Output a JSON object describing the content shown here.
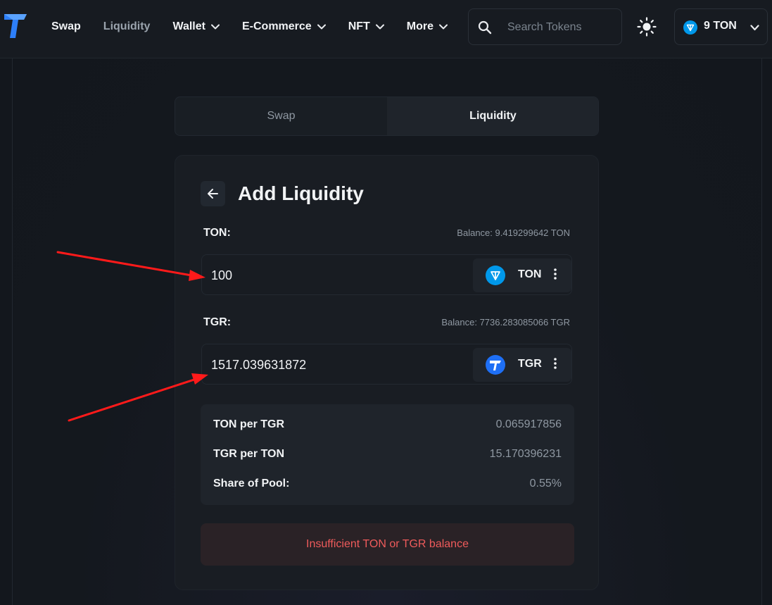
{
  "nav": {
    "items": [
      {
        "label": "Swap",
        "dropdown": false,
        "muted": false
      },
      {
        "label": "Liquidity",
        "dropdown": false,
        "muted": true
      },
      {
        "label": "Wallet",
        "dropdown": true,
        "muted": false
      },
      {
        "label": "E-Commerce",
        "dropdown": true,
        "muted": false
      },
      {
        "label": "NFT",
        "dropdown": true,
        "muted": false
      },
      {
        "label": "More",
        "dropdown": true,
        "muted": false
      }
    ],
    "search_placeholder": "Search Tokens",
    "wallet_label": "9 TON"
  },
  "tabs": {
    "swap": "Swap",
    "liquidity": "Liquidity",
    "active": "liquidity"
  },
  "panel": {
    "title": "Add Liquidity",
    "token_a": {
      "label": "TON:",
      "balance": "Balance: 9.419299642 TON",
      "amount": "100",
      "symbol": "TON"
    },
    "token_b": {
      "label": "TGR:",
      "balance": "Balance: 7736.283085066 TGR",
      "amount": "1517.039631872",
      "symbol": "TGR"
    },
    "info": [
      {
        "key": "TON per TGR",
        "value": "0.065917856"
      },
      {
        "key": "TGR per TON",
        "value": "15.170396231"
      },
      {
        "key": "Share of Pool:",
        "value": "0.55%"
      }
    ],
    "warning_button": "Insufficient TON or TGR balance"
  },
  "colors": {
    "background": "#13171d",
    "panel": "#191d23",
    "ton_blue": "#0098ea",
    "tgr_blue": "#1e6ff5",
    "warning_text": "#ef5b5b",
    "annotation_arrow": "#ff1a1a"
  },
  "icons": [
    "logo-icon",
    "chevron-down-icon",
    "search-icon",
    "sun-icon",
    "ton-icon",
    "tgr-icon",
    "back-arrow-icon",
    "kebab-menu-icon"
  ]
}
